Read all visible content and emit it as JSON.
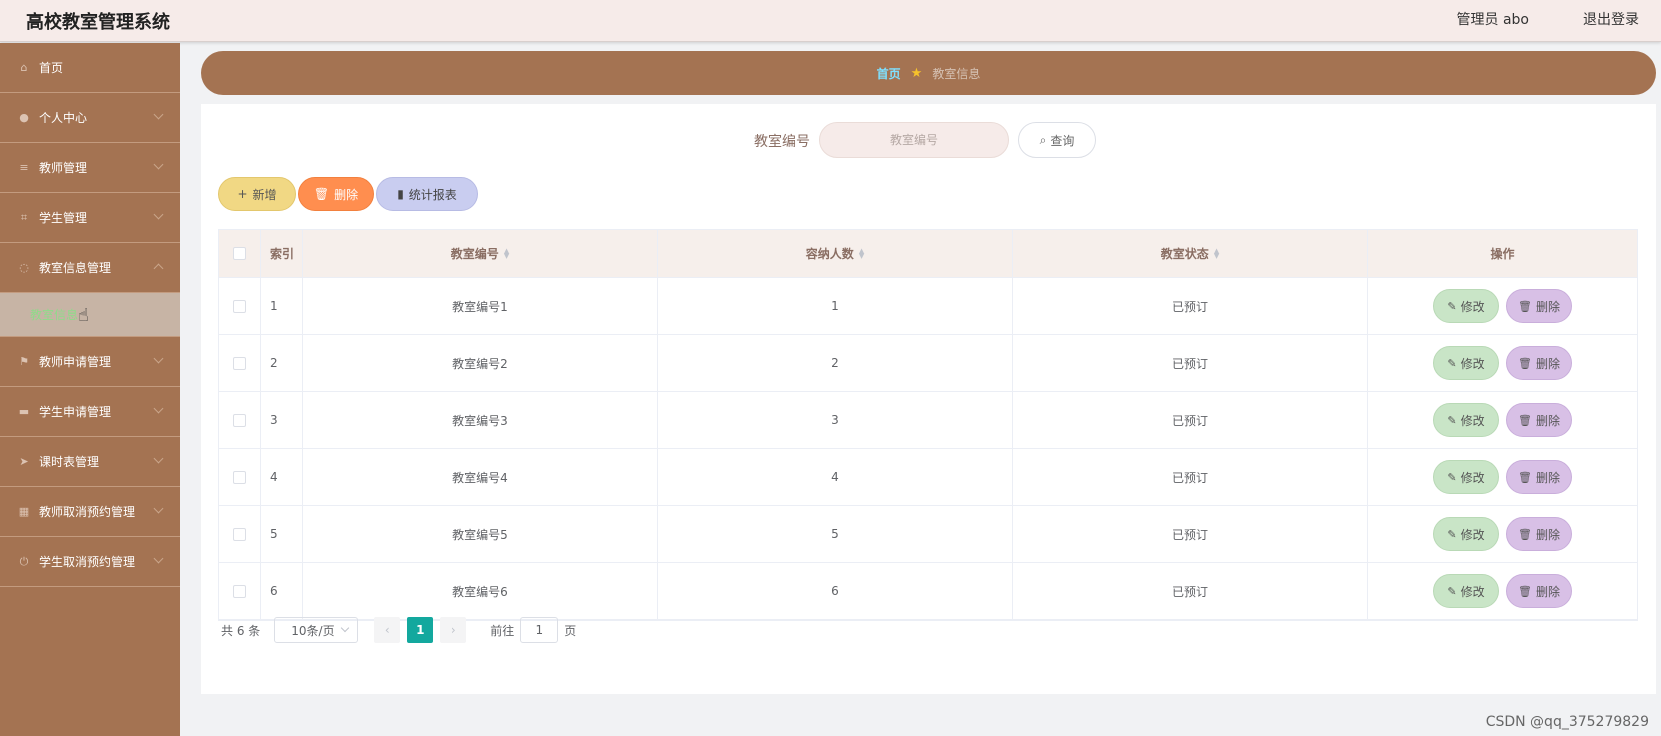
{
  "header": {
    "title": "高校教室管理系统",
    "user": "管理员 abo",
    "logout": "退出登录"
  },
  "sidebar": {
    "items": [
      {
        "label": "首页",
        "icon": "home-icon",
        "glyph": "⌂",
        "arrow": ""
      },
      {
        "label": "个人中心",
        "icon": "user-icon",
        "glyph": "●",
        "arrow": "down"
      },
      {
        "label": "教师管理",
        "icon": "sliders-icon",
        "glyph": "≡",
        "arrow": "down"
      },
      {
        "label": "学生管理",
        "icon": "crop-icon",
        "glyph": "⌗",
        "arrow": "down"
      },
      {
        "label": "教室信息管理",
        "icon": "spinner-icon",
        "glyph": "◌",
        "arrow": "up"
      }
    ],
    "subitem": {
      "label": "教室信息"
    },
    "items_after": [
      {
        "label": "教师申请管理",
        "icon": "flag-icon",
        "glyph": "⚑",
        "arrow": "down"
      },
      {
        "label": "学生申请管理",
        "icon": "wallet-icon",
        "glyph": "▬",
        "arrow": "down"
      },
      {
        "label": "课时表管理",
        "icon": "send-icon",
        "glyph": "➤",
        "arrow": "down"
      },
      {
        "label": "教师取消预约管理",
        "icon": "calendar-icon",
        "glyph": "▦",
        "arrow": "down"
      },
      {
        "label": "学生取消预约管理",
        "icon": "power-icon",
        "glyph": "⏻",
        "arrow": "down"
      }
    ]
  },
  "breadcrumb": {
    "home": "首页",
    "current": "教室信息"
  },
  "search": {
    "label": "教室编号",
    "placeholder": "教室编号",
    "button": "查询"
  },
  "actions": {
    "add": "新增",
    "delete": "删除",
    "report": "统计报表"
  },
  "table": {
    "headers": {
      "index": "索引",
      "room": "教室编号",
      "capacity": "容纳人数",
      "status": "教室状态",
      "ops": "操作"
    },
    "rows": [
      {
        "index": "1",
        "room": "教室编号1",
        "capacity": "1",
        "status": "已预订"
      },
      {
        "index": "2",
        "room": "教室编号2",
        "capacity": "2",
        "status": "已预订"
      },
      {
        "index": "3",
        "room": "教室编号3",
        "capacity": "3",
        "status": "已预订"
      },
      {
        "index": "4",
        "room": "教室编号4",
        "capacity": "4",
        "status": "已预订"
      },
      {
        "index": "5",
        "room": "教室编号5",
        "capacity": "5",
        "status": "已预订"
      },
      {
        "index": "6",
        "room": "教室编号6",
        "capacity": "6",
        "status": "已预订"
      }
    ],
    "edit_label": "修改",
    "delete_label": "删除"
  },
  "pagination": {
    "total": "共 6 条",
    "page_size": "10条/页",
    "current_page": "1",
    "goto_prefix": "前往",
    "goto_value": "1",
    "goto_suffix": "页"
  },
  "watermark": "CSDN @qq_375279829",
  "colors": {
    "sidebar": "#a47352",
    "header": "#f6ebe9",
    "accent": "#13a89e"
  }
}
